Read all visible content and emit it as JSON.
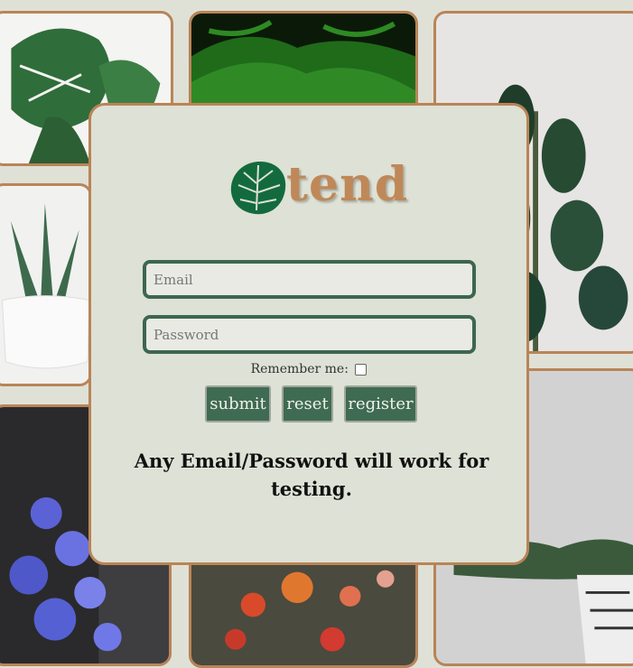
{
  "brand": {
    "name": "tend",
    "logo_icon": "monstera-leaf-icon"
  },
  "form": {
    "email_placeholder": "Email",
    "password_placeholder": "Password",
    "remember_label": "Remember me:",
    "remember_checked": false,
    "submit_label": "submit",
    "reset_label": "reset",
    "register_label": "register"
  },
  "note": "Any Email/Password will work for testing.",
  "colors": {
    "background": "#dfe1d6",
    "accent_green": "#3e6b51",
    "accent_tan": "#bf8858"
  },
  "gallery": [
    "monstera-plant-photo",
    "fern-plant-photo",
    "rubber-plant-photo",
    "succulent-plant-photo",
    "orchid-plant-photo",
    "dahlia-flowers-photo",
    "bonsai-plant-photo"
  ]
}
